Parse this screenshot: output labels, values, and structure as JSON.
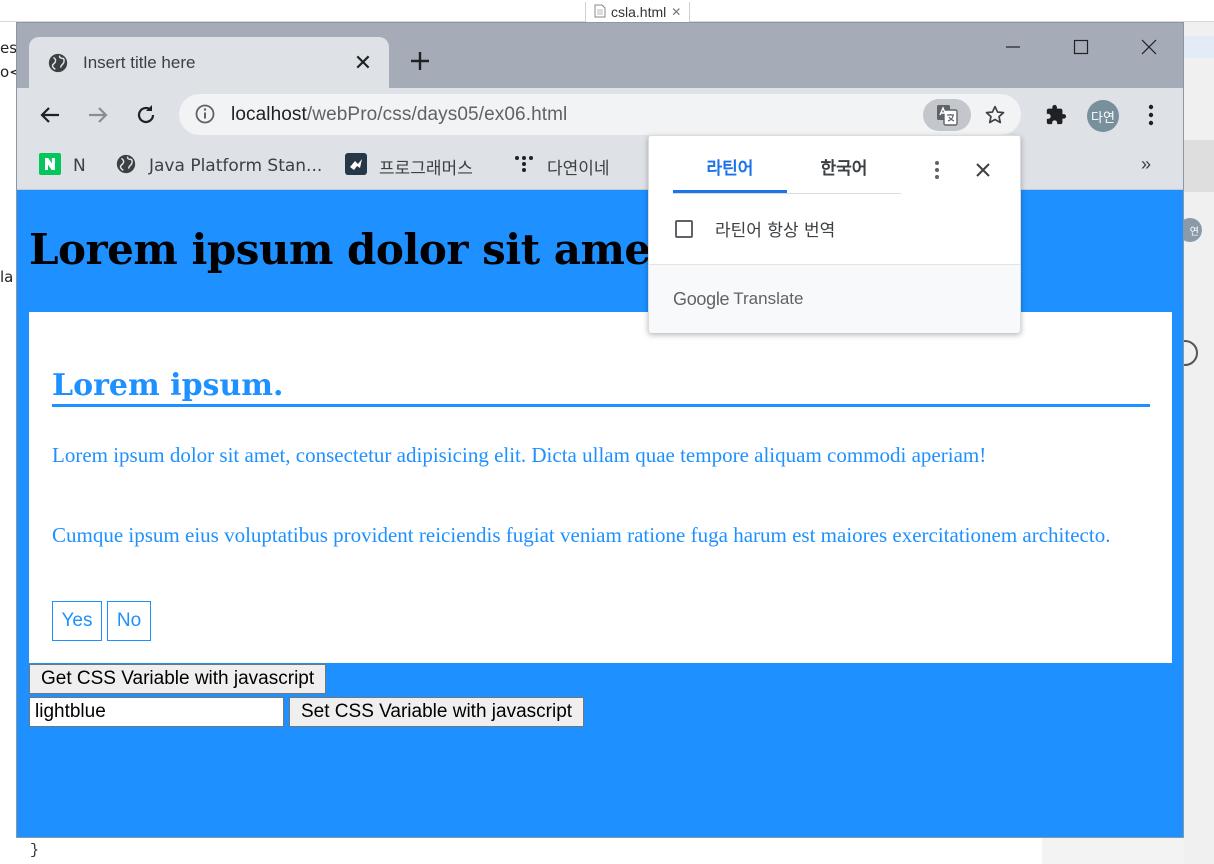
{
  "background": {
    "editor_tab_label": "csla.html",
    "left_text_fragments": [
      "es",
      "o<",
      "la"
    ],
    "right_avatar_fragment": "연",
    "bottom_code": "}"
  },
  "browser": {
    "tab_title": "Insert title here",
    "url_host": "localhost",
    "url_path": "/webPro/css/days05/ex06.html",
    "profile_label": "다연",
    "bookmarks": [
      {
        "label": "N",
        "icon": "naver-icon"
      },
      {
        "label": "Java Platform Stan...",
        "icon": "globe-icon"
      },
      {
        "label": "프로그래머스",
        "icon": "programmers-icon"
      },
      {
        "label": "다연이네",
        "icon": "dots-logo-icon"
      }
    ],
    "bookmarks_more": "»"
  },
  "translate_popup": {
    "tabs": [
      {
        "label": "라틴어",
        "active": true
      },
      {
        "label": "한국어",
        "active": false
      }
    ],
    "checkbox_label": "라틴어 항상 번역",
    "footer_google": "Google",
    "footer_translate": "Translate"
  },
  "page": {
    "heading": "Lorem ipsum dolor sit amet.",
    "card": {
      "heading": "Lorem ipsum.",
      "paragraph1": "Lorem ipsum dolor sit amet, consectetur adipisicing elit. Dicta ullam quae tempore aliquam commodi aperiam!",
      "paragraph2": "Cumque ipsum eius voluptatibus provident reiciendis fugiat veniam ratione fuga harum est maiores exercitationem architecto.",
      "yes_label": "Yes",
      "no_label": "No"
    },
    "get_button_label": "Get CSS Variable with javascript",
    "set_button_label": "Set CSS Variable with javascript",
    "color_input_value": "lightblue"
  },
  "colors": {
    "page_background": "#1e90ff",
    "accent": "#1e90ff",
    "translate_active": "#1a73e8"
  }
}
